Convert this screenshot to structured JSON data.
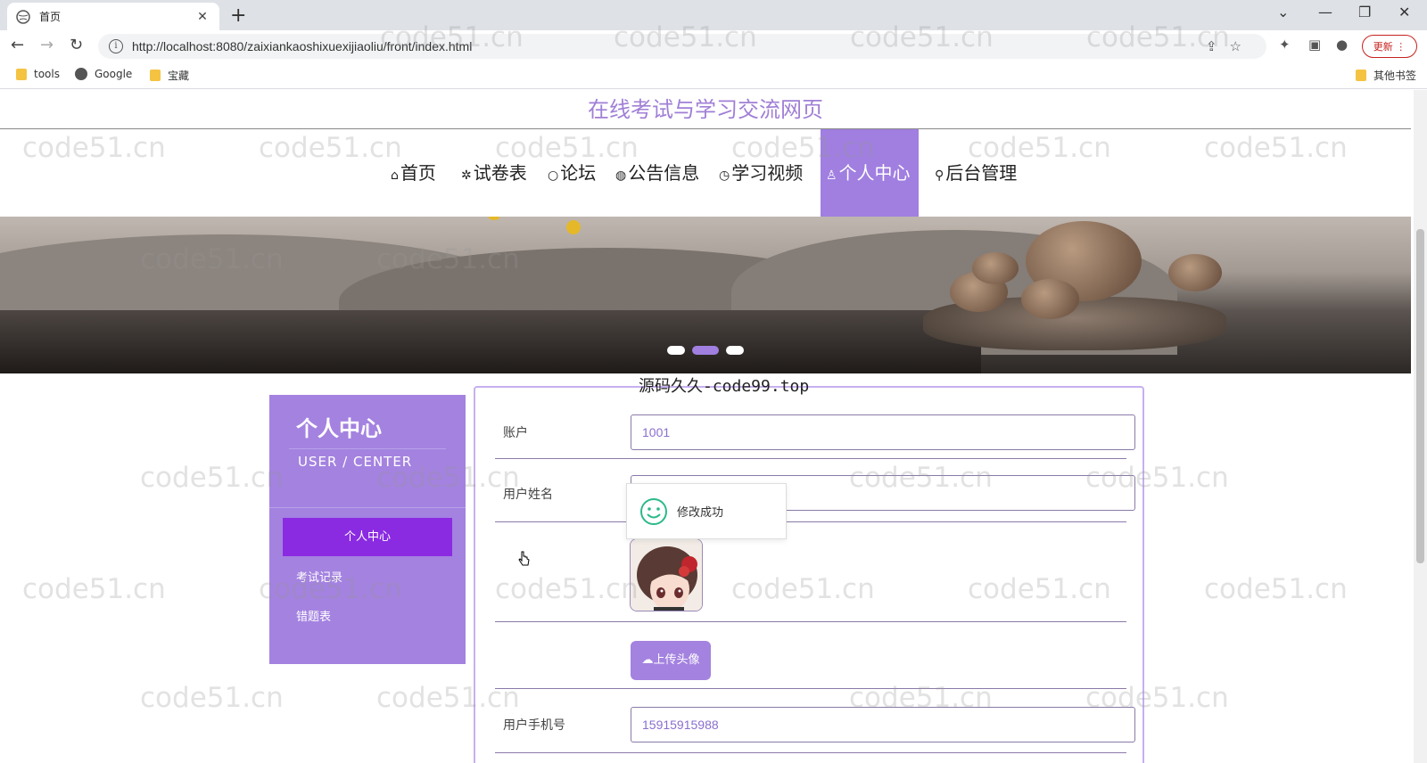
{
  "browser": {
    "tab_title": "首页",
    "url": "http://localhost:8080/zaixiankaoshixuexijiaoliu/front/index.html",
    "update_label": "更新",
    "bookmarks": [
      "tools",
      "Google",
      "宝藏"
    ],
    "other_bookmarks": "其他书签"
  },
  "site": {
    "title": "在线考试与学习交流网页"
  },
  "nav": [
    {
      "icon": "⌂",
      "label": "首页"
    },
    {
      "icon": "✲",
      "label": "试卷表"
    },
    {
      "icon": "○",
      "label": "论坛"
    },
    {
      "icon": "◍",
      "label": "公告信息"
    },
    {
      "icon": "◷",
      "label": "学习视频"
    },
    {
      "icon": "♙",
      "label": "个人中心"
    },
    {
      "icon": "⚲",
      "label": "后台管理"
    }
  ],
  "carousel": {
    "slides": 3,
    "active": 1
  },
  "sidebar": {
    "title": "个人中心",
    "subtitle": "USER / CENTER",
    "active_item": "个人中心",
    "items": [
      "考试记录",
      "错题表"
    ]
  },
  "form": {
    "top_watermark": "源码久久-code99.top",
    "account_label": "账户",
    "account_value": "1001",
    "name_label": "用户姓名",
    "name_value": "",
    "upload_label": "上传头像",
    "phone_label": "用户手机号",
    "phone_value": "15915915988"
  },
  "toast": {
    "message": "修改成功"
  },
  "watermark_text": "code51.cn"
}
